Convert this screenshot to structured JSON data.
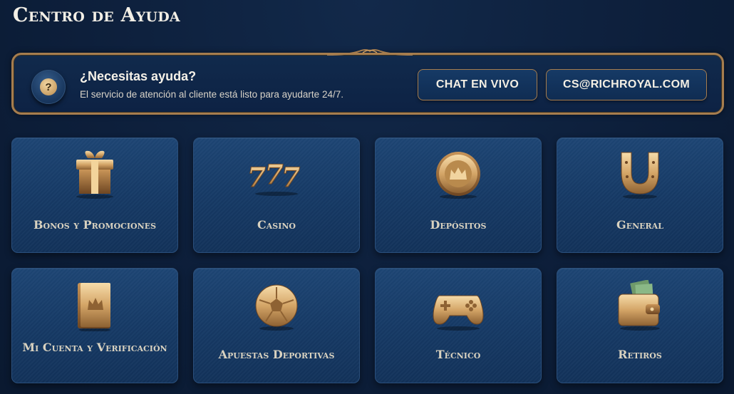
{
  "page": {
    "title": "Centro de Ayuda"
  },
  "banner": {
    "icon": "question-icon",
    "title": "¿Necesitas ayuda?",
    "text": "El servicio de atención al cliente está listo para ayudarte 24/7.",
    "chat_label": "CHAT EN VIVO",
    "email_label": "CS@RICHROYAL.COM"
  },
  "categories": [
    {
      "label": "Bonos y Promociones",
      "icon": "gift-icon"
    },
    {
      "label": "Casino",
      "icon": "slot-777-icon"
    },
    {
      "label": "Depósitos",
      "icon": "crown-coin-icon"
    },
    {
      "label": "General",
      "icon": "horseshoe-icon"
    },
    {
      "label": "Mi Cuenta y Verificación",
      "icon": "crown-book-icon"
    },
    {
      "label": "Apuestas Deportivas",
      "icon": "soccer-ball-icon"
    },
    {
      "label": "Técnico",
      "icon": "gamepad-icon"
    },
    {
      "label": "Retiros",
      "icon": "wallet-icon"
    }
  ],
  "colors": {
    "gold": "#a67d4e",
    "background": "#0d1f3b",
    "card": "#163a66"
  }
}
